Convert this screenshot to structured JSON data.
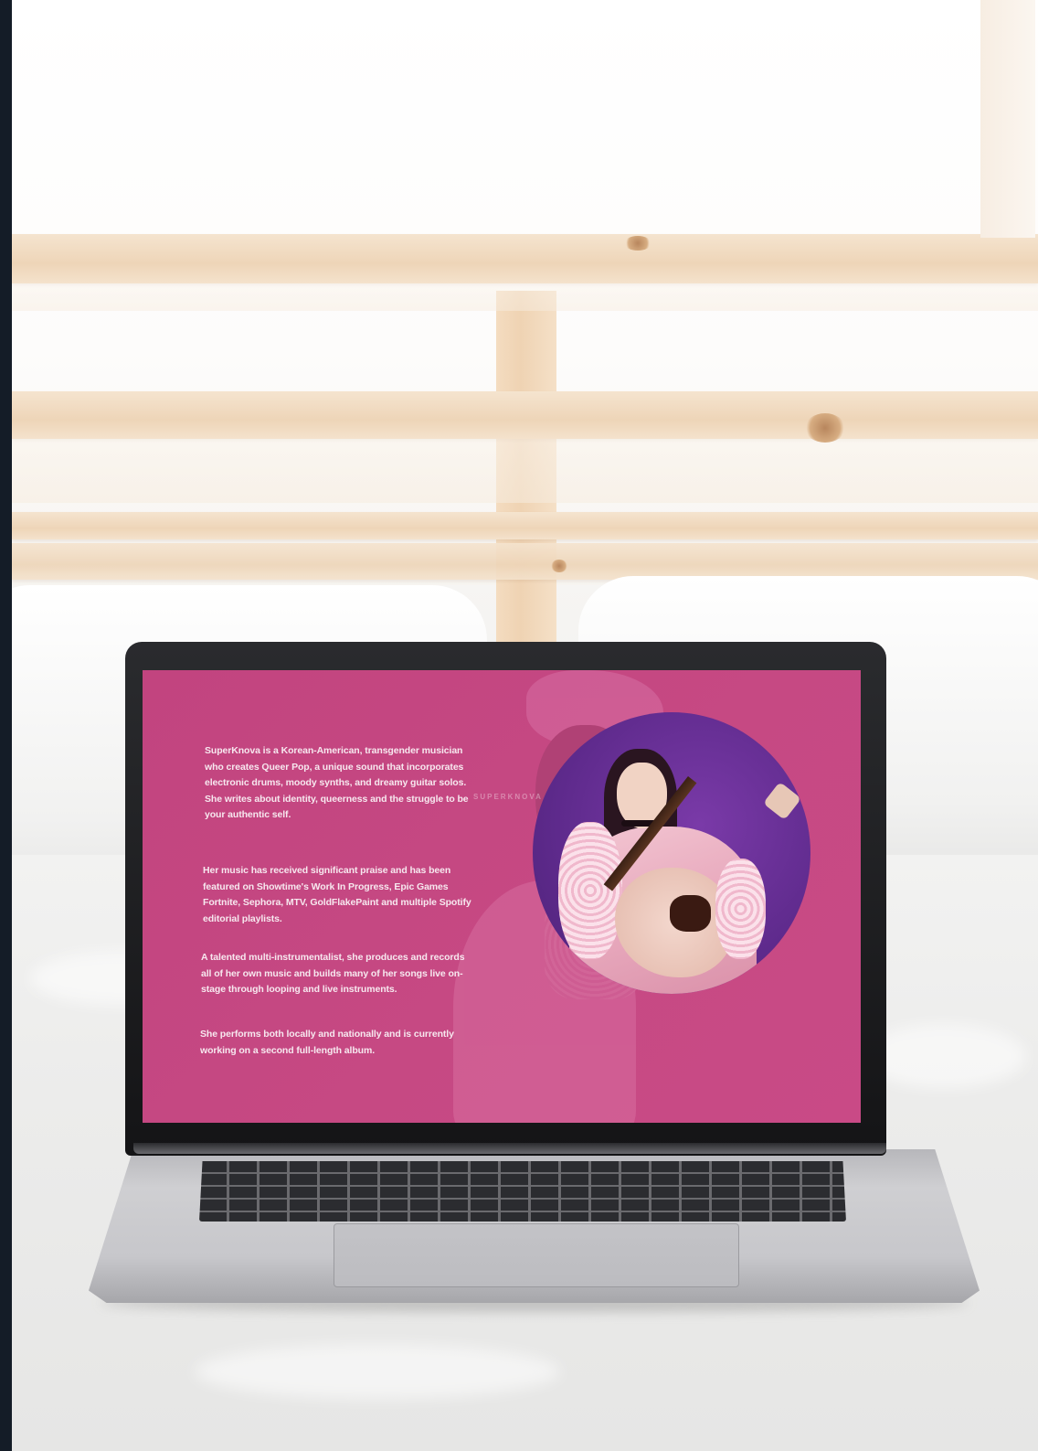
{
  "scene": {
    "description_objects": [
      "window-shutters",
      "bed",
      "laptop"
    ]
  },
  "screen": {
    "background_color": "#c64983",
    "watermark": "SUPERKNOVA",
    "paragraphs": [
      "SuperKnova is a Korean-American, transgender musician who creates Queer Pop, a unique sound that incorporates electronic drums, moody synths, and dreamy guitar solos. She writes about identity, queerness and the struggle to be your authentic self.",
      "Her music has received significant praise and has been featured on Showtime's Work In Progress, Epic Games Fortnite, Sephora, MTV, GoldFlakePaint and multiple Spotify editorial playlists.",
      "A talented multi-instrumentalist, she produces and records all of her own music and builds many of her songs live on-stage through looping and live instruments.",
      "She performs both locally and nationally and is currently working on a second full-length album."
    ],
    "portrait_bg_color": "#5e2a8c"
  }
}
